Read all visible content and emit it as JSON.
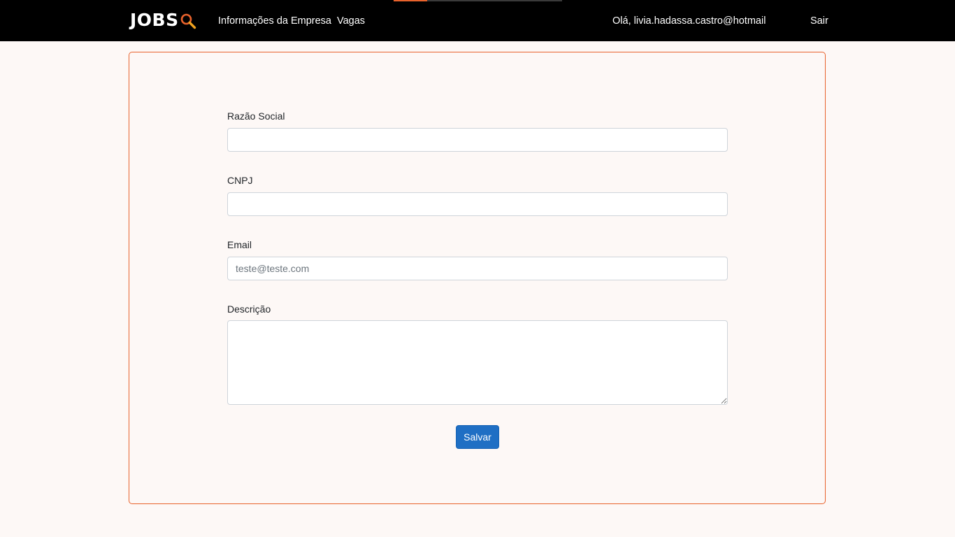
{
  "brand": {
    "logo_text": "JOBS",
    "icon": "magnifier-icon",
    "accent_color": "#e8622c"
  },
  "nav": {
    "links": [
      {
        "label": "Informações da Empresa"
      },
      {
        "label": "Vagas"
      }
    ],
    "greeting": "Olá, livia.hadassa.castro@hotmail",
    "logout_label": "Sair"
  },
  "loading_bar": {
    "progress_fraction": 0.2,
    "color": "#e8622c"
  },
  "form": {
    "fields": [
      {
        "label": "Razão Social",
        "value": "",
        "placeholder": ""
      },
      {
        "label": "CNPJ",
        "value": "",
        "placeholder": ""
      },
      {
        "label": "Email",
        "value": "",
        "placeholder": "teste@teste.com"
      },
      {
        "label": "Descrição",
        "value": "",
        "placeholder": ""
      }
    ],
    "submit_label": "Salvar",
    "submit_color": "#1f6fc4"
  }
}
